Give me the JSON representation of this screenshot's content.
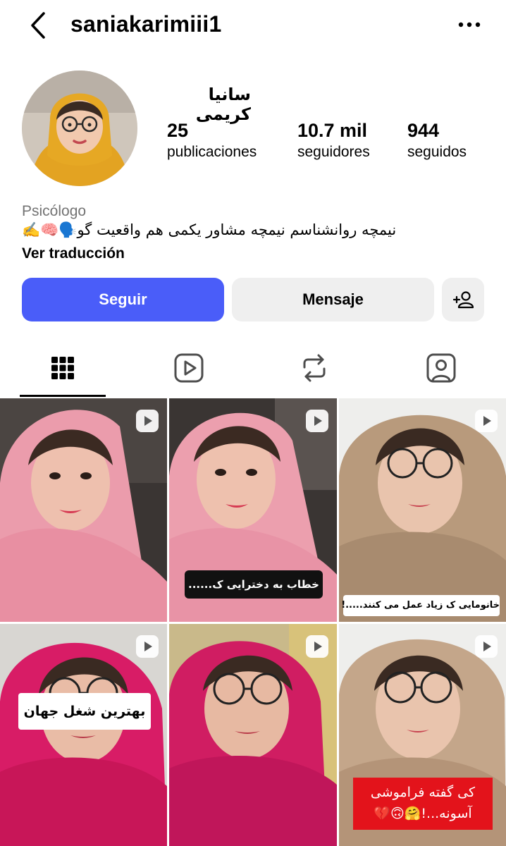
{
  "header": {
    "username": "saniakarimiii1",
    "back_icon": "chevron-left-icon",
    "more_icon": "more-horizontal-icon"
  },
  "profile": {
    "display_name": "سانیا کریمی",
    "stats": {
      "posts": {
        "value": "25",
        "label": "publicaciones"
      },
      "followers": {
        "value": "10.7 mil",
        "label": "seguidores"
      },
      "following": {
        "value": "944",
        "label": "seguidos"
      }
    },
    "category": "Psicólogo",
    "bio": "نیمچه روانشناسم نیمچه مشاور یکمی هم واقعیت گو🗣️🧠✍️",
    "translate_label": "Ver traducción"
  },
  "actions": {
    "follow_label": "Seguir",
    "message_label": "Mensaje",
    "suggest_icon": "add-person-icon",
    "accent_color": "#4a5df9"
  },
  "tabs": [
    {
      "name": "posts",
      "icon": "grid-icon",
      "active": true
    },
    {
      "name": "reels",
      "icon": "reels-icon",
      "active": false
    },
    {
      "name": "reposts",
      "icon": "repost-icon",
      "active": false
    },
    {
      "name": "tagged",
      "icon": "tagged-icon",
      "active": false
    }
  ],
  "grid": {
    "posts": [
      {
        "type": "reel",
        "caption": ""
      },
      {
        "type": "reel",
        "caption": "خطاب به دخترایی ک......"
      },
      {
        "type": "reel",
        "caption": "خانومایی ک زیاد عمل می کنند.....!"
      },
      {
        "type": "reel",
        "caption": "بهترین شغل جهان"
      },
      {
        "type": "reel",
        "caption": ""
      },
      {
        "type": "reel",
        "caption": "کی گفته فراموشی آسونه...!🤗🙃💔"
      }
    ]
  }
}
